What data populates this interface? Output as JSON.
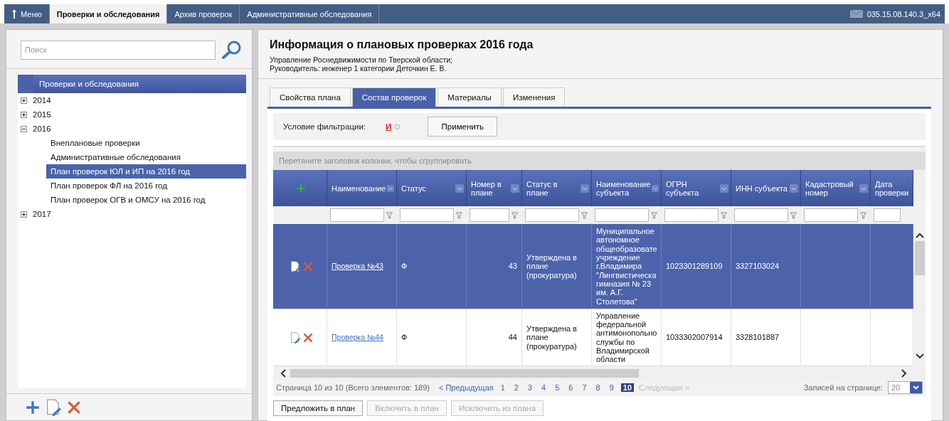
{
  "top_nav": {
    "tabs": [
      {
        "label": "Меню",
        "kind": "menu",
        "selected": false
      },
      {
        "label": "Проверки и обследования",
        "kind": "tab",
        "selected": true
      },
      {
        "label": "Архив проверок",
        "kind": "tab",
        "selected": false
      },
      {
        "label": "Административные обследования",
        "kind": "tab",
        "selected": false
      }
    ],
    "version": "035.15.08.140.3_x64"
  },
  "sidebar": {
    "search": {
      "placeholder": "Поиск"
    },
    "tree": {
      "title": "Проверки и обследования",
      "items": [
        {
          "label": "2014",
          "expanded": false,
          "selected": false
        },
        {
          "label": "2015",
          "expanded": false,
          "selected": false
        },
        {
          "label": "2016",
          "expanded": true,
          "selected": false,
          "children": [
            {
              "label": "Внеплановые проверки",
              "selected": false
            },
            {
              "label": "Административные обследования",
              "selected": false
            },
            {
              "label": "План проверок ЮЛ и ИП на 2016 год",
              "selected": true
            },
            {
              "label": "План проверок ФЛ на 2016 год",
              "selected": false
            },
            {
              "label": "План проверок ОГВ и ОМСУ на 2016 год",
              "selected": false
            }
          ]
        },
        {
          "label": "2017",
          "expanded": false,
          "selected": false
        }
      ]
    }
  },
  "main": {
    "title": "Информация о плановых проверках 2016 года",
    "subtitle_lines": [
      "Управление Роснедвижимости по Тверской области;",
      "Руководитель: инженер 1 категории Деточкин Е. В."
    ],
    "tabs": [
      {
        "label": "Свойства плана",
        "selected": false
      },
      {
        "label": "Состав проверок",
        "selected": true
      },
      {
        "label": "Материалы",
        "selected": false
      },
      {
        "label": "Изменения",
        "selected": false
      }
    ],
    "filter": {
      "label": "Условие фильтрации:",
      "operator": "И",
      "apply_button": "Применить"
    },
    "group_hint": "Перетяните заголовок колонки, чтобы сгруппировать",
    "columns": [
      "Наименование",
      "Статус",
      "Номер в плане",
      "Статус в плане",
      "Наименование субъекта",
      "ОГРН субъекта",
      "ИНН субъекта",
      "Кадастровый номер",
      "Дата проверки"
    ],
    "rows": [
      {
        "selected": true,
        "name": "Проверка №43",
        "status": "Ф",
        "number": "43",
        "plan_status": "Утверждена в плане (прокуратура)",
        "subject": "Муниципальное\nавтономное\nобщеобразовате\nучреждение\nг.Владимира\n\"Лингвистическа\nгимназия № 23\nим. А.Г.\nСтолетова\"",
        "ogrn": "1023301289109",
        "inn": "3327103024"
      },
      {
        "selected": false,
        "name": "Проверка №44",
        "status": "Ф",
        "number": "44",
        "plan_status": "Утверждена в плане (прокуратура)",
        "subject": "Управление\nфедеральной\nантимонопольно\nслужбы по\nВладимирской\nобласти",
        "ogrn": "1033302007914",
        "inn": "3328101887"
      }
    ],
    "pager": {
      "summary": "Страница 10 из 10 (Всего элементов: 189)",
      "prev": {
        "label": "< Предыдущая",
        "disabled": false
      },
      "pages": [
        {
          "label": "1",
          "selected": false
        },
        {
          "label": "2",
          "selected": false
        },
        {
          "label": "3",
          "selected": false
        },
        {
          "label": "4",
          "selected": false
        },
        {
          "label": "5",
          "selected": false
        },
        {
          "label": "6",
          "selected": false
        },
        {
          "label": "7",
          "selected": false
        },
        {
          "label": "8",
          "selected": false
        },
        {
          "label": "9",
          "selected": false
        },
        {
          "label": "10",
          "selected": true
        }
      ],
      "next": {
        "label": "Следующая >",
        "disabled": true
      },
      "page_size_label": "Записей на странице:",
      "page_size": "20"
    },
    "buttons": [
      {
        "label": "Предложить в план",
        "disabled": false
      },
      {
        "label": "Включить в план",
        "disabled": true
      },
      {
        "label": "Исключить из плана",
        "disabled": true
      }
    ]
  }
}
